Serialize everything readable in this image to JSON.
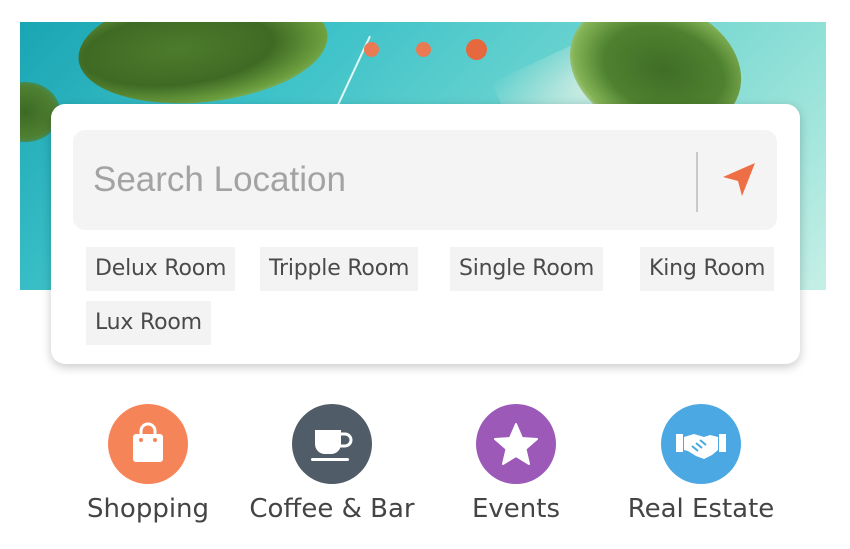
{
  "hero": {
    "carousel_dots": 3,
    "active_dot": 3,
    "dot_color": "#e97a54"
  },
  "search": {
    "placeholder": "Search Location",
    "value": "",
    "locate_icon": "navigation-arrow-icon",
    "accent_color": "#ee6e45"
  },
  "room_tags": [
    {
      "label": "Delux Room"
    },
    {
      "label": "Tripple Room"
    },
    {
      "label": "Single Room"
    },
    {
      "label": "King Room"
    },
    {
      "label": "Lux Room"
    }
  ],
  "categories": [
    {
      "label": "Shopping",
      "icon": "shopping-bag-icon",
      "color": "#f58459"
    },
    {
      "label": "Coffee & Bar",
      "icon": "coffee-cup-icon",
      "color": "#505d69"
    },
    {
      "label": "Events",
      "icon": "star-icon",
      "color": "#9c59b8"
    },
    {
      "label": "Real Estate",
      "icon": "handshake-icon",
      "color": "#4ba8e3"
    }
  ]
}
